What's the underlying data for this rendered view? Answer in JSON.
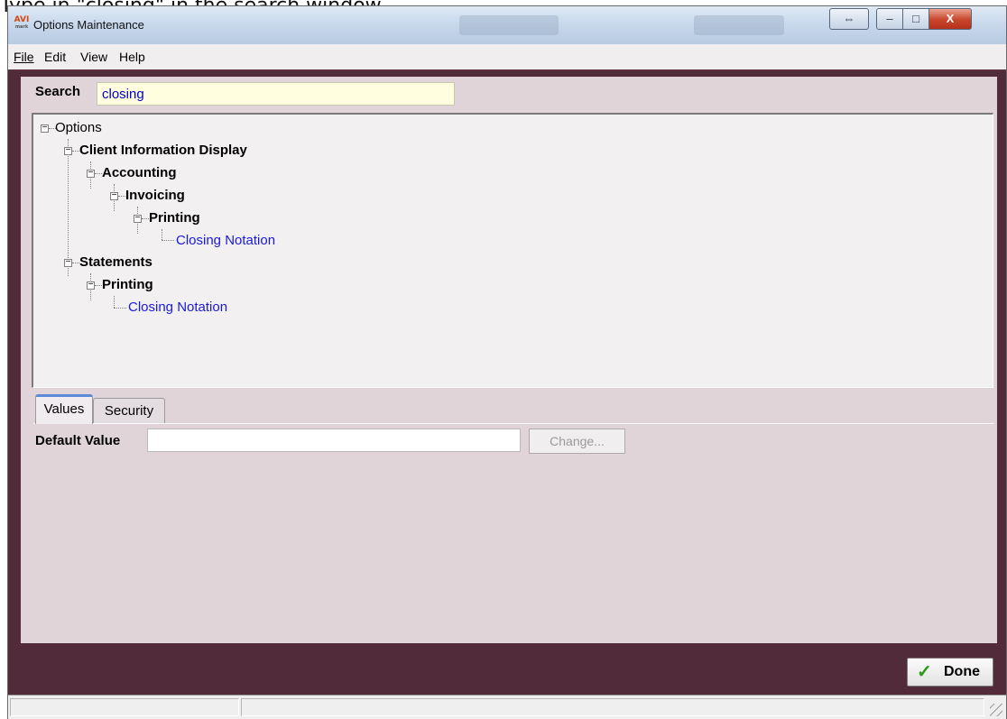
{
  "caption": "Type in \"closing\" in the search window.",
  "window": {
    "title": "Options Maintenance",
    "app_icon_text": "AVI",
    "app_icon_sub": "mark",
    "controls": {
      "swap": "⇔",
      "minimize": "–",
      "maximize": "□",
      "close": "X"
    }
  },
  "menu": {
    "items": [
      "File",
      "Edit",
      "View",
      "Help"
    ]
  },
  "search": {
    "label": "Search",
    "value": "closing"
  },
  "tree": {
    "root": "Options",
    "client_info": "Client Information Display",
    "accounting": "Accounting",
    "invoicing": "Invoicing",
    "printing_1": "Printing",
    "closing_1": "Closing Notation",
    "statements": "Statements",
    "printing_2": "Printing",
    "closing_2": "Closing Notation"
  },
  "tabs": {
    "values": "Values",
    "security": "Security"
  },
  "default_value": {
    "label": "Default Value",
    "value": "",
    "change_button": "Change..."
  },
  "done": {
    "label": "Done"
  },
  "colors": {
    "frame": "#522b3a",
    "panel": "#e0d4d8",
    "leaf_link": "#1a1adc",
    "search_bg": "#ffffe0"
  }
}
